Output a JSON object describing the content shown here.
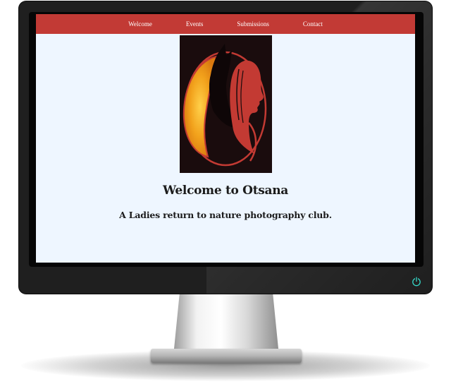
{
  "site": {
    "nav": [
      {
        "label": "Welcome"
      },
      {
        "label": "Events"
      },
      {
        "label": "Submissions"
      },
      {
        "label": "Contact"
      }
    ],
    "heading": "Welcome to Otsana",
    "tagline": "A Ladies return to nature photography club."
  },
  "colors": {
    "nav_bar": "#c23a35",
    "page_background": "#eef6ff",
    "art_background": "#1a0c0d",
    "moon": "#f0a21a",
    "outline": "#c33a33"
  },
  "icons": {
    "logo": "wolf-moon-woman-logo",
    "power": "power-icon"
  }
}
